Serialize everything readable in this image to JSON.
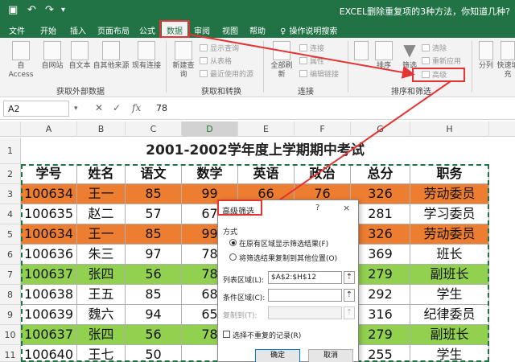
{
  "titlebar": {
    "title": "EXCEL删除重复项的3种方法，你知道几种?",
    "save_icon": "save-icon",
    "undo_icon": "undo-icon",
    "redo_icon": "redo-icon"
  },
  "tabs": [
    {
      "label": "文件"
    },
    {
      "label": "开始"
    },
    {
      "label": "插入"
    },
    {
      "label": "页面布局"
    },
    {
      "label": "公式"
    },
    {
      "label": "数据"
    },
    {
      "label": "审阅"
    },
    {
      "label": "视图"
    },
    {
      "label": "帮助"
    }
  ],
  "tell_me": "操作说明搜索",
  "ribbon": {
    "group_external": {
      "label": "获取外部数据",
      "buttons": [
        "自 Access",
        "自网站",
        "自文本",
        "自其他来源",
        "现有连接"
      ]
    },
    "group_transform": {
      "label": "获取和转换",
      "new_query": "新建查询",
      "show_query": "显示查询",
      "from_table": "从表格",
      "recent_sources": "最近使用的源"
    },
    "group_connections": {
      "label": "连接",
      "refresh_all": "全部刷新",
      "connections": "连接",
      "properties": "属性",
      "edit_links": "编辑链接"
    },
    "group_sort_filter": {
      "label": "排序和筛选",
      "sort": "排序",
      "filter": "筛选",
      "clear": "清除",
      "reapply": "重新应用",
      "advanced": "高级"
    },
    "group_tools": {
      "split": "分列",
      "flash_fill": "快速填充"
    }
  },
  "formula_bar": {
    "name_box": "A2",
    "value": "78",
    "fx": "fx"
  },
  "columns": [
    "A",
    "B",
    "C",
    "D",
    "E",
    "F",
    "G",
    "H"
  ],
  "rows": [
    "1",
    "2",
    "3",
    "4",
    "5",
    "6",
    "7",
    "8",
    "9",
    "10",
    "11"
  ],
  "sheet": {
    "title": "2001-2002学年度上学期期中考试",
    "headers": [
      "学号",
      "姓名",
      "语文",
      "数学",
      "英语",
      "政治",
      "总分",
      "职务"
    ],
    "data": [
      {
        "fill": "orange",
        "cells": [
          "100634",
          "王一",
          "85",
          "99",
          "66",
          "76",
          "326",
          "劳动委员"
        ]
      },
      {
        "fill": "none",
        "cells": [
          "100635",
          "赵二",
          "57",
          "67",
          "",
          "",
          "281",
          "学习委员"
        ]
      },
      {
        "fill": "orange",
        "cells": [
          "100634",
          "王一",
          "85",
          "99",
          "",
          "",
          "326",
          "劳动委员"
        ]
      },
      {
        "fill": "none",
        "cells": [
          "100636",
          "朱三",
          "97",
          "78",
          "",
          "",
          "369",
          "班长"
        ]
      },
      {
        "fill": "green",
        "cells": [
          "100637",
          "张四",
          "56",
          "78",
          "",
          "",
          "279",
          "副班长"
        ]
      },
      {
        "fill": "none",
        "cells": [
          "100638",
          "王五",
          "85",
          "68",
          "",
          "",
          "292",
          "学生"
        ]
      },
      {
        "fill": "none",
        "cells": [
          "100639",
          "魏六",
          "94",
          "65",
          "",
          "",
          "316",
          "纪律委员"
        ]
      },
      {
        "fill": "green",
        "cells": [
          "100637",
          "张四",
          "56",
          "78",
          "",
          "",
          "279",
          "副班长"
        ]
      },
      {
        "fill": "none",
        "cells": [
          "100640",
          "王七",
          "50",
          "",
          "",
          "",
          "255",
          "学生"
        ]
      }
    ]
  },
  "dialog": {
    "title": "高级筛选",
    "help": "?",
    "close": "×",
    "mode_label": "方式",
    "option_in_place": "在原有区域显示筛选结果(F)",
    "option_copy": "将筛选结果复制到其他位置(O)",
    "list_range_label": "列表区域(L):",
    "list_range_value": "$A$2:$H$12",
    "criteria_range_label": "条件区域(C):",
    "criteria_range_value": "",
    "copy_to_label": "复制到(T):",
    "copy_to_value": "",
    "unique_label": "选择不重复的记录(R)",
    "ok": "确定",
    "cancel": "取消"
  },
  "colors": {
    "excel_green": "#217346",
    "duplicate_orange": "#ed7d31",
    "duplicate_green": "#92d050",
    "annotation_red": "#e53333"
  }
}
